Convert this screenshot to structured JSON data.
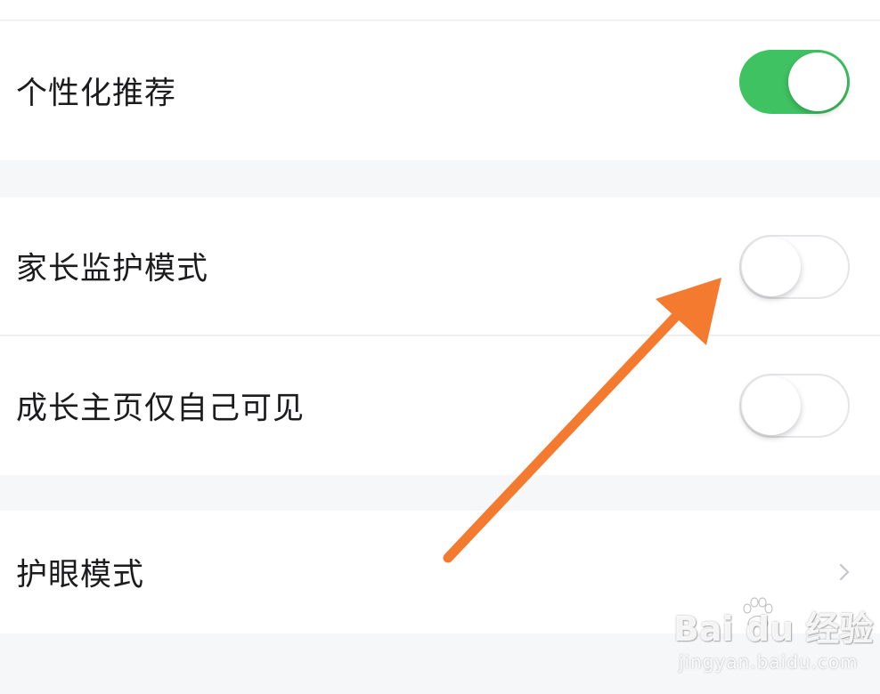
{
  "settings": {
    "items": [
      {
        "label": "个性化推荐",
        "type": "toggle",
        "on": true
      },
      {
        "label": "家长监护模式",
        "type": "toggle",
        "on": false
      },
      {
        "label": "成长主页仅自己可见",
        "type": "toggle",
        "on": false
      },
      {
        "label": "护眼模式",
        "type": "link"
      }
    ]
  },
  "colors": {
    "toggle_on": "#3fc262",
    "annotation_arrow": "#f47a30",
    "section_gap": "#f6f7f9"
  },
  "watermark": {
    "brand": "Bai du 经验",
    "url": "jingyan.baidu.com"
  }
}
